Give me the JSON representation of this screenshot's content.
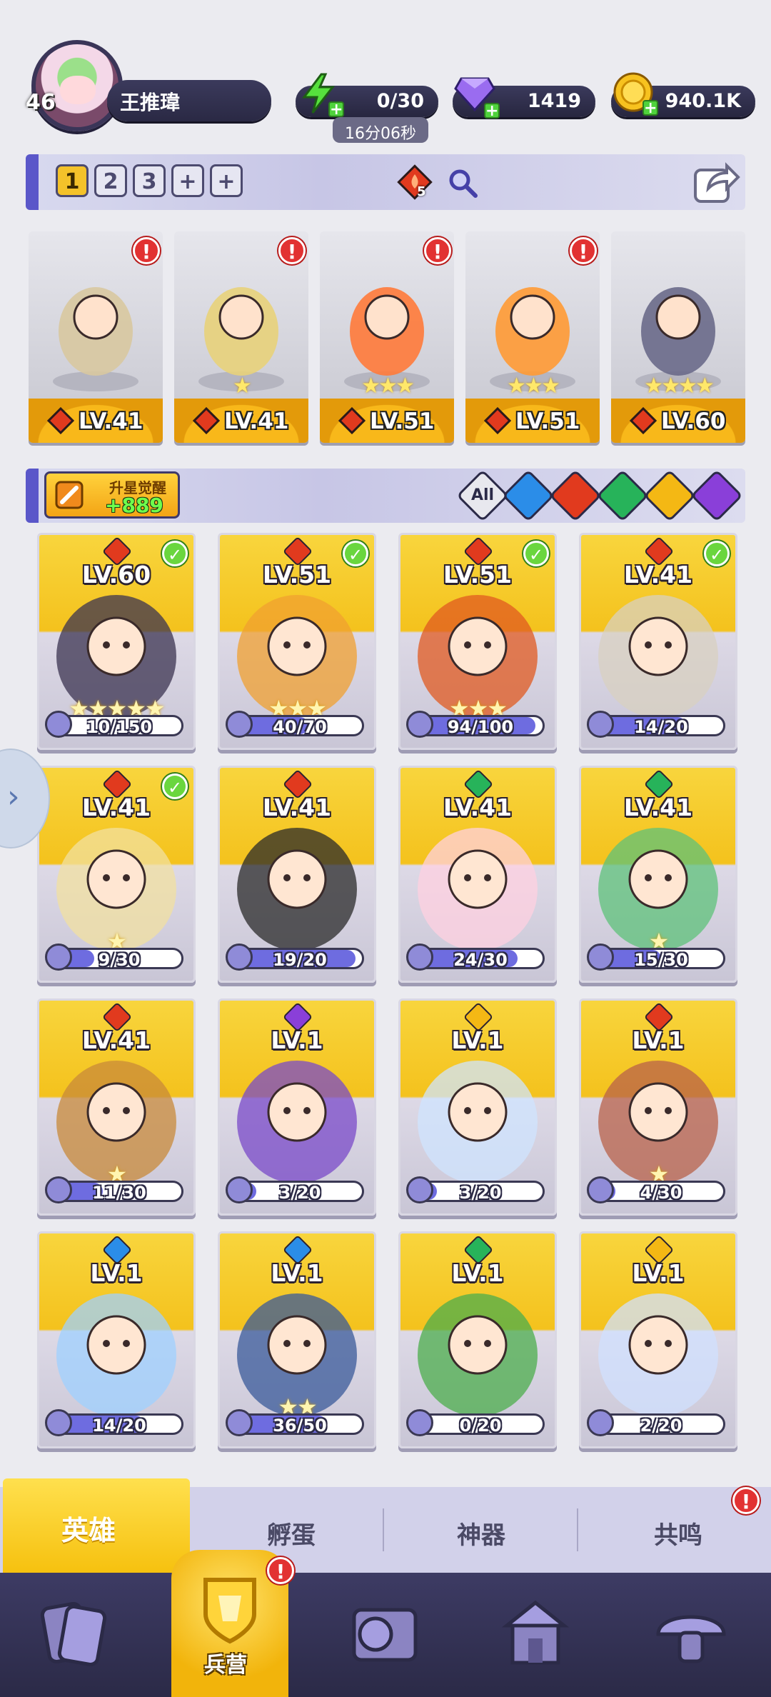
{
  "profile": {
    "level": "46",
    "name": "王推瑋"
  },
  "resources": {
    "energy": {
      "value": "0/30",
      "icon": "lightning-icon",
      "timer": "16分06秒"
    },
    "gems": {
      "value": "1419",
      "icon": "gem-icon"
    },
    "coins": {
      "value": "940.1K",
      "icon": "coin-icon"
    }
  },
  "team_bar": {
    "tabs": [
      "1",
      "2",
      "3",
      "+",
      "+"
    ],
    "active_tab": "1",
    "fire_count": "5"
  },
  "team": [
    {
      "level": "LV.41",
      "stars": "",
      "alert": "!"
    },
    {
      "level": "LV.41",
      "stars": "★",
      "alert": "!"
    },
    {
      "level": "LV.51",
      "stars": "★★★",
      "alert": "!"
    },
    {
      "level": "LV.51",
      "stars": "★★★",
      "alert": "!"
    },
    {
      "level": "LV.60",
      "stars": "★★★★",
      "alert": ""
    }
  ],
  "filter_bar": {
    "star_button_title": "升星觉醒",
    "star_button_value": "+889",
    "all_label": "All",
    "elements": [
      "water",
      "fire",
      "nature",
      "light",
      "dark"
    ]
  },
  "heroes": [
    {
      "level": "LV.60",
      "elem": "fire",
      "checked": true,
      "stars": "★★★★★",
      "shards": "10/150",
      "progress": 0.067
    },
    {
      "level": "LV.51",
      "elem": "fire",
      "checked": true,
      "stars": "★★★",
      "shards": "40/70",
      "progress": 0.571
    },
    {
      "level": "LV.51",
      "elem": "fire",
      "checked": true,
      "stars": "★★★",
      "shards": "94/100",
      "progress": 0.94
    },
    {
      "level": "LV.41",
      "elem": "fire",
      "checked": true,
      "stars": "",
      "shards": "14/20",
      "progress": 0.7
    },
    {
      "level": "LV.41",
      "elem": "fire",
      "checked": true,
      "stars": "★",
      "shards": "9/30",
      "progress": 0.3
    },
    {
      "level": "LV.41",
      "elem": "fire",
      "checked": false,
      "stars": "",
      "shards": "19/20",
      "progress": 0.95
    },
    {
      "level": "LV.41",
      "elem": "nature",
      "checked": false,
      "stars": "",
      "shards": "24/30",
      "progress": 0.8
    },
    {
      "level": "LV.41",
      "elem": "nature",
      "checked": false,
      "stars": "★",
      "shards": "15/30",
      "progress": 0.5
    },
    {
      "level": "LV.41",
      "elem": "fire",
      "checked": false,
      "stars": "★",
      "shards": "11/30",
      "progress": 0.367
    },
    {
      "level": "LV.1",
      "elem": "dark",
      "checked": false,
      "stars": "",
      "shards": "3/20",
      "progress": 0.15
    },
    {
      "level": "LV.1",
      "elem": "light",
      "checked": false,
      "stars": "",
      "shards": "3/20",
      "progress": 0.15
    },
    {
      "level": "LV.1",
      "elem": "fire",
      "checked": false,
      "stars": "★",
      "shards": "4/30",
      "progress": 0.133
    },
    {
      "level": "LV.1",
      "elem": "water",
      "checked": false,
      "stars": "",
      "shards": "14/20",
      "progress": 0.7
    },
    {
      "level": "LV.1",
      "elem": "water",
      "checked": false,
      "stars": "★★",
      "shards": "36/50",
      "progress": 0.72
    },
    {
      "level": "LV.1",
      "elem": "nature",
      "checked": false,
      "stars": "",
      "shards": "0/20",
      "progress": 0.0
    },
    {
      "level": "LV.1",
      "elem": "light",
      "checked": false,
      "stars": "",
      "shards": "2/20",
      "progress": 0.1
    }
  ],
  "sub_tabs": [
    {
      "label": "英雄",
      "active": true
    },
    {
      "label": "孵蛋",
      "active": false
    },
    {
      "label": "神器",
      "active": false
    },
    {
      "label": "共鸣",
      "active": false,
      "alert": "!"
    }
  ],
  "bottom_nav": [
    {
      "icon": "cards-icon",
      "label": ""
    },
    {
      "icon": "barracks-icon",
      "label": "兵营",
      "active": true,
      "alert": "!"
    },
    {
      "icon": "map-icon",
      "label": ""
    },
    {
      "icon": "shrine-icon",
      "label": ""
    },
    {
      "icon": "mushroom-icon",
      "label": ""
    }
  ],
  "colors": {
    "fire": "#e13a1e",
    "water": "#2b8de8",
    "nature": "#27b35a",
    "light": "#f4b814",
    "dark": "#8a3fd9",
    "accent": "#5a57c9"
  }
}
